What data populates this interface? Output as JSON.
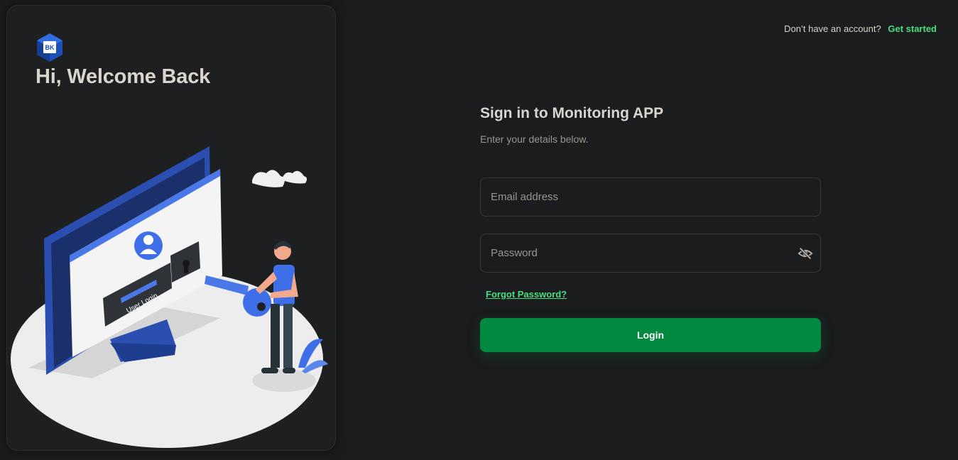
{
  "left_panel": {
    "logo_text": "BK",
    "welcome_title": "Hi, Welcome Back",
    "illustration_caption": "User Login"
  },
  "header": {
    "prompt": "Don’t have an account?",
    "get_started": "Get started"
  },
  "form": {
    "title": "Sign in to Monitoring APP",
    "subtitle": "Enter your details below.",
    "email_placeholder": "Email address",
    "password_placeholder": "Password",
    "forgot_password": "Forgot Password?",
    "login_label": "Login"
  },
  "colors": {
    "background": "#1b1c1d",
    "accent": "#4ade80",
    "primary_button": "#00893f",
    "illustration_blue": "#3f6fe8"
  },
  "icons": {
    "password_toggle": "eye-off-icon"
  }
}
